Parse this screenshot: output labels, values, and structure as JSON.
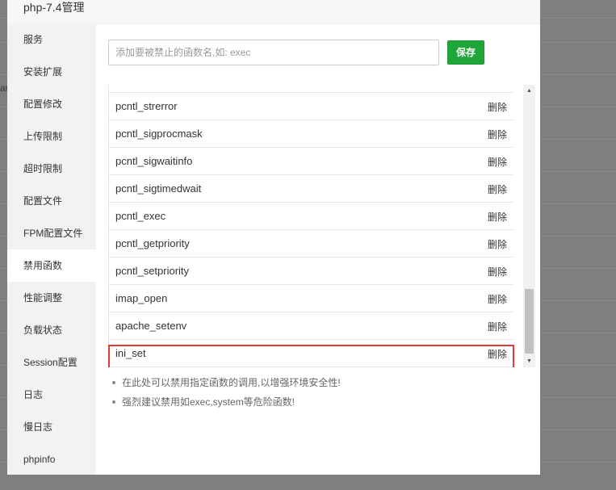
{
  "dialog": {
    "title": "php-7.4管理",
    "close_icon": "close-icon"
  },
  "background": {
    "scrap_text": "ar"
  },
  "sidebar": {
    "items": [
      {
        "label": "服务"
      },
      {
        "label": "安装扩展"
      },
      {
        "label": "配置修改"
      },
      {
        "label": "上传限制"
      },
      {
        "label": "超时限制"
      },
      {
        "label": "配置文件"
      },
      {
        "label": "FPM配置文件"
      },
      {
        "label": "禁用函数",
        "active": true
      },
      {
        "label": "性能调整"
      },
      {
        "label": "负载状态"
      },
      {
        "label": "Session配置"
      },
      {
        "label": "日志"
      },
      {
        "label": "慢日志"
      },
      {
        "label": "phpinfo"
      }
    ]
  },
  "form": {
    "placeholder": "添加要被禁止的函数名,如: exec",
    "value": "",
    "save_label": "保存"
  },
  "table": {
    "rows": [
      {
        "name": "pcntl_strerror",
        "action": "删除"
      },
      {
        "name": "pcntl_sigprocmask",
        "action": "删除"
      },
      {
        "name": "pcntl_sigwaitinfo",
        "action": "删除"
      },
      {
        "name": "pcntl_sigtimedwait",
        "action": "删除"
      },
      {
        "name": "pcntl_exec",
        "action": "删除"
      },
      {
        "name": "pcntl_getpriority",
        "action": "删除"
      },
      {
        "name": "pcntl_setpriority",
        "action": "删除"
      },
      {
        "name": "imap_open",
        "action": "删除"
      },
      {
        "name": "apache_setenv",
        "action": "删除"
      },
      {
        "name": "ini_set",
        "action": "删除",
        "highlighted": true
      }
    ]
  },
  "tips": [
    "在此处可以禁用指定函数的调用,以增强环境安全性!",
    "强烈建议禁用如exec,system等危险函数!"
  ],
  "colors": {
    "accent": "#20a53a",
    "highlight_border": "#e53935"
  }
}
